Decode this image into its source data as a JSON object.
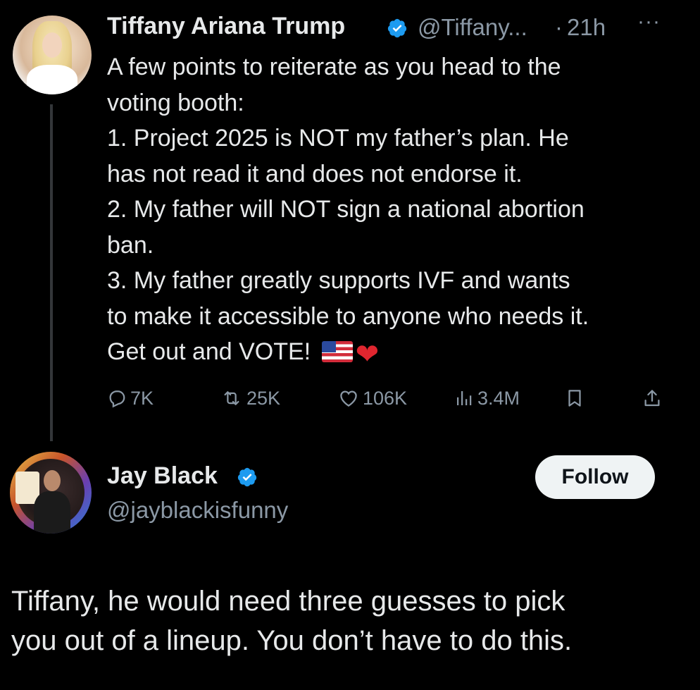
{
  "post": {
    "author_name": "Tiffany Ariana Trump",
    "author_handle": "@Tiffany...",
    "separator": "·",
    "time": "21h",
    "more_label": "···",
    "text_before_emoji": "A few points to reiterate as you head to the\nvoting booth:\n1. Project 2025 is NOT my father’s plan. He\nhas not read it and does not endorse it.\n2. My father will NOT sign a national abortion\nban.\n3. My father greatly supports IVF and wants\nto make it accessible to anyone who needs it.\nGet out and VOTE! ",
    "emoji_heart": "❤",
    "actions": {
      "replies": "7K",
      "reposts": "25K",
      "likes": "106K",
      "views": "3.4M"
    }
  },
  "reply_user": {
    "name": "Jay Black",
    "handle": "@jayblackisfunny",
    "follow_label": "Follow",
    "text": "Tiffany, he would need three guesses to pick\nyou out of a lineup. You don’t have to do this."
  },
  "colors": {
    "background": "#000000",
    "text": "#e7e9ea",
    "muted": "#8b98a5",
    "verified": "#1d9bf0",
    "thread_line": "#333639",
    "follow_bg": "#eff3f4"
  },
  "icons": [
    "verified-badge-icon",
    "more-icon",
    "reply-icon",
    "repost-icon",
    "like-icon",
    "views-icon",
    "bookmark-icon",
    "share-icon",
    "flag-us-emoji",
    "heart-emoji"
  ]
}
